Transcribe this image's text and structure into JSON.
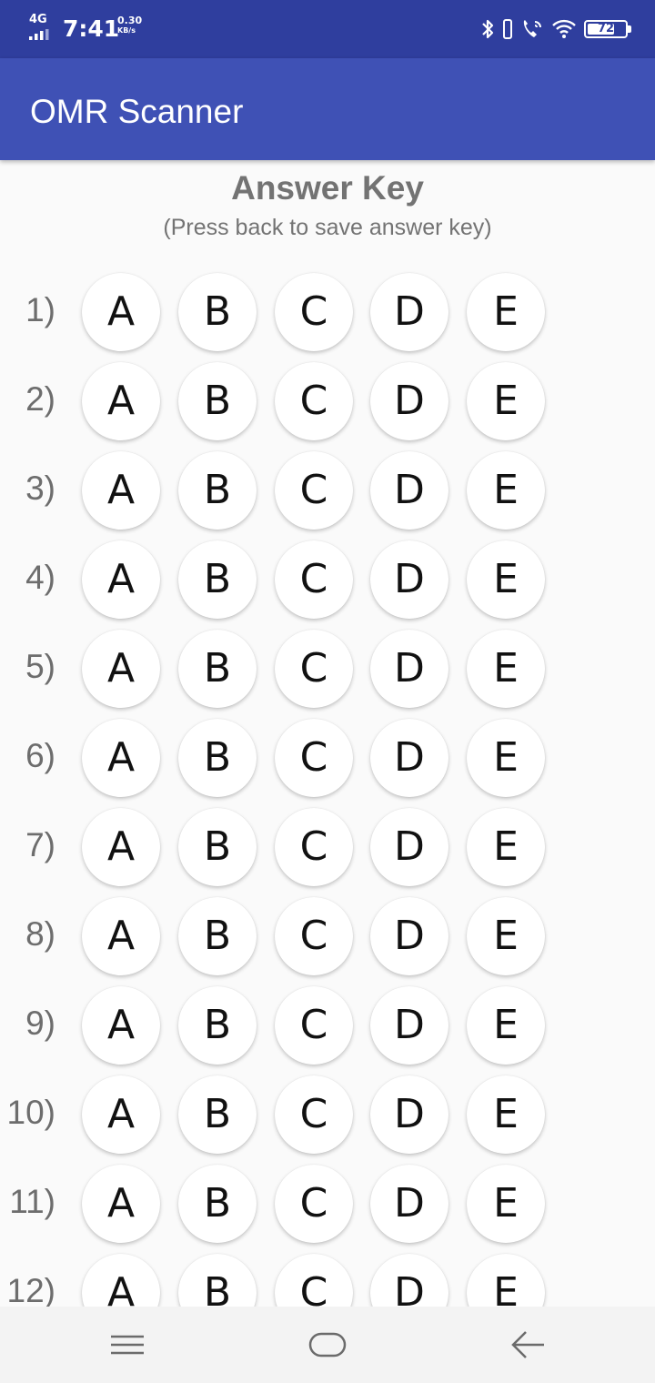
{
  "status_bar": {
    "network": "4G",
    "time": "7:41",
    "speed_value": "0.30",
    "speed_unit": "KB/s",
    "battery_percent": "72",
    "icons": [
      "bluetooth-icon",
      "vibrate-icon",
      "wifi-calling-icon",
      "wifi-icon",
      "battery-icon"
    ]
  },
  "app_bar": {
    "title": "OMR Scanner"
  },
  "answer_key": {
    "title": "Answer Key",
    "subtitle": "(Press back to save answer key)",
    "options": [
      "A",
      "B",
      "C",
      "D",
      "E"
    ],
    "questions": [
      {
        "number": "1)"
      },
      {
        "number": "2)"
      },
      {
        "number": "3)"
      },
      {
        "number": "4)"
      },
      {
        "number": "5)"
      },
      {
        "number": "6)"
      },
      {
        "number": "7)"
      },
      {
        "number": "8)"
      },
      {
        "number": "9)"
      },
      {
        "number": "10)"
      },
      {
        "number": "11)"
      },
      {
        "number": "12)"
      }
    ]
  },
  "nav_bar": {
    "icons": [
      "menu-icon",
      "home-icon",
      "back-arrow-icon"
    ]
  },
  "colors": {
    "status_bar": "#2f3e9e",
    "app_bar": "#3f51b5",
    "background": "#fafafa",
    "secondary_text": "#737373"
  }
}
